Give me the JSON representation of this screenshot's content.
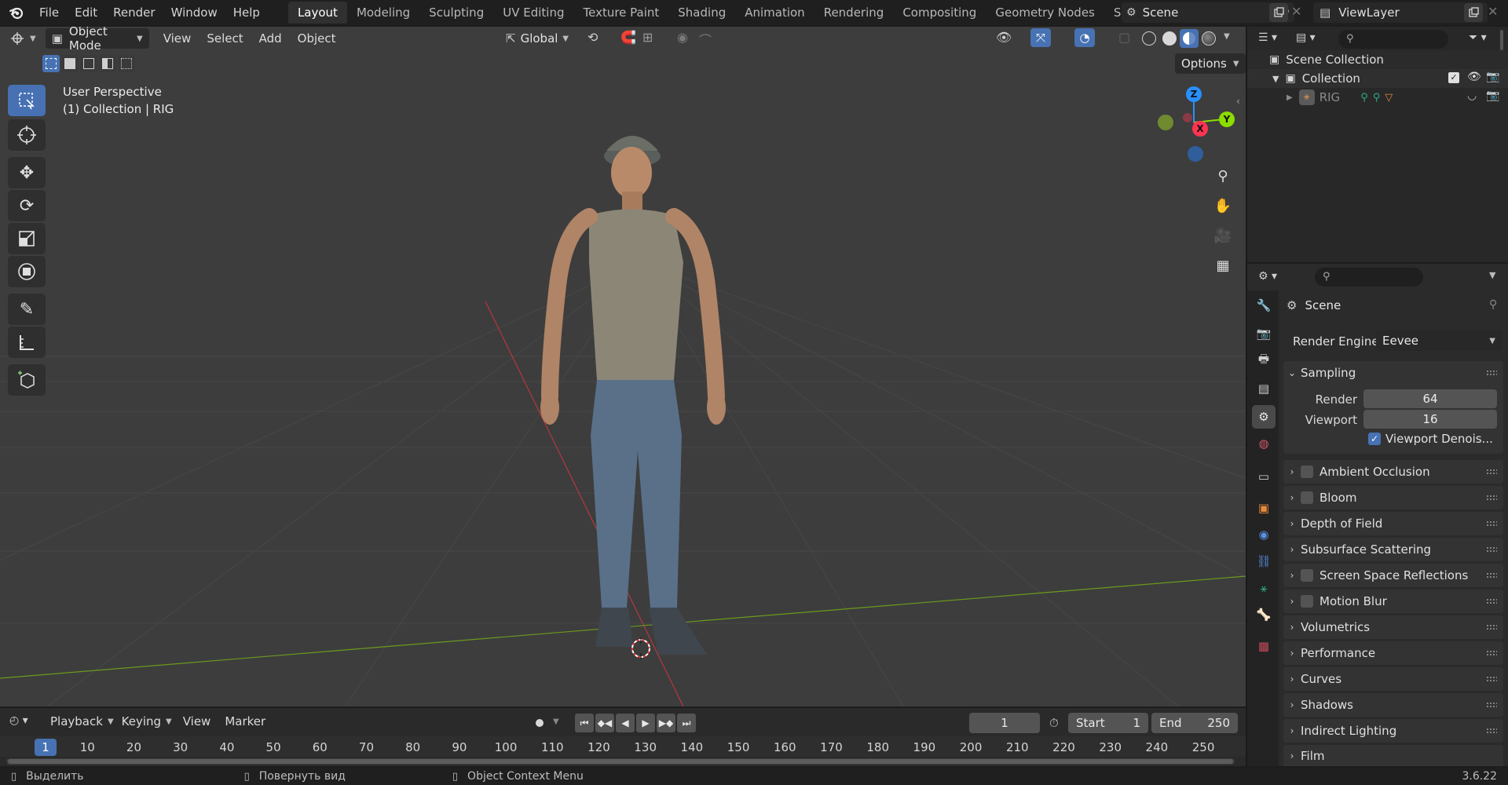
{
  "topbar": {
    "menus": [
      "File",
      "Edit",
      "Render",
      "Window",
      "Help"
    ],
    "workspaces": [
      {
        "label": "Layout",
        "active": true
      },
      {
        "label": "Modeling",
        "active": false
      },
      {
        "label": "Sculpting",
        "active": false
      },
      {
        "label": "UV Editing",
        "active": false
      },
      {
        "label": "Texture Paint",
        "active": false
      },
      {
        "label": "Shading",
        "active": false
      },
      {
        "label": "Animation",
        "active": false
      },
      {
        "label": "Rendering",
        "active": false
      },
      {
        "label": "Compositing",
        "active": false
      },
      {
        "label": "Geometry Nodes",
        "active": false
      },
      {
        "label": "Scripting",
        "active": false
      }
    ],
    "scene_name": "Scene",
    "view_layer": "ViewLayer"
  },
  "viewport": {
    "mode": "Object Mode",
    "menus": [
      "View",
      "Select",
      "Add",
      "Object"
    ],
    "transform_orientation": "Global",
    "options_label": "Options",
    "overlay_title": "User Perspective",
    "overlay_subtitle": "(1) Collection | RIG",
    "gizmo": {
      "x": "X",
      "y": "Y",
      "z": "Z"
    }
  },
  "outliner": {
    "root": "Scene Collection",
    "collection": "Collection",
    "object": "RIG"
  },
  "properties": {
    "context": "Scene",
    "render_engine_label": "Render Engine",
    "render_engine": "Eevee",
    "sampling": {
      "label": "Sampling",
      "render_label": "Render",
      "render_value": "64",
      "viewport_label": "Viewport",
      "viewport_value": "16",
      "denoise_label": "Viewport Denois..."
    },
    "panels": [
      {
        "label": "Ambient Occlusion",
        "checkbox": true
      },
      {
        "label": "Bloom",
        "checkbox": true
      },
      {
        "label": "Depth of Field",
        "checkbox": false
      },
      {
        "label": "Subsurface Scattering",
        "checkbox": false
      },
      {
        "label": "Screen Space Reflections",
        "checkbox": true
      },
      {
        "label": "Motion Blur",
        "checkbox": true
      },
      {
        "label": "Volumetrics",
        "checkbox": false
      },
      {
        "label": "Performance",
        "checkbox": false
      },
      {
        "label": "Curves",
        "checkbox": false
      },
      {
        "label": "Shadows",
        "checkbox": false
      },
      {
        "label": "Indirect Lighting",
        "checkbox": false
      },
      {
        "label": "Film",
        "checkbox": false
      }
    ]
  },
  "timeline": {
    "menus": [
      "Playback",
      "Keying",
      "View",
      "Marker"
    ],
    "current_frame": "1",
    "start_label": "Start",
    "start_value": "1",
    "end_label": "End",
    "end_value": "250",
    "ruler": [
      "1",
      "10",
      "20",
      "30",
      "40",
      "50",
      "60",
      "70",
      "80",
      "90",
      "100",
      "110",
      "120",
      "130",
      "140",
      "150",
      "160",
      "170",
      "180",
      "190",
      "200",
      "210",
      "220",
      "230",
      "240",
      "250"
    ]
  },
  "statusbar": {
    "select": "Выделить",
    "rotate": "Повернуть вид",
    "context_menu": "Object Context Menu",
    "version": "3.6.22"
  },
  "colors": {
    "accent": "#4772b3",
    "viewport_bg": "#3d3d3d",
    "axis_x": "#ff3352",
    "axis_y": "#8bdc00",
    "axis_z": "#2890ff"
  }
}
